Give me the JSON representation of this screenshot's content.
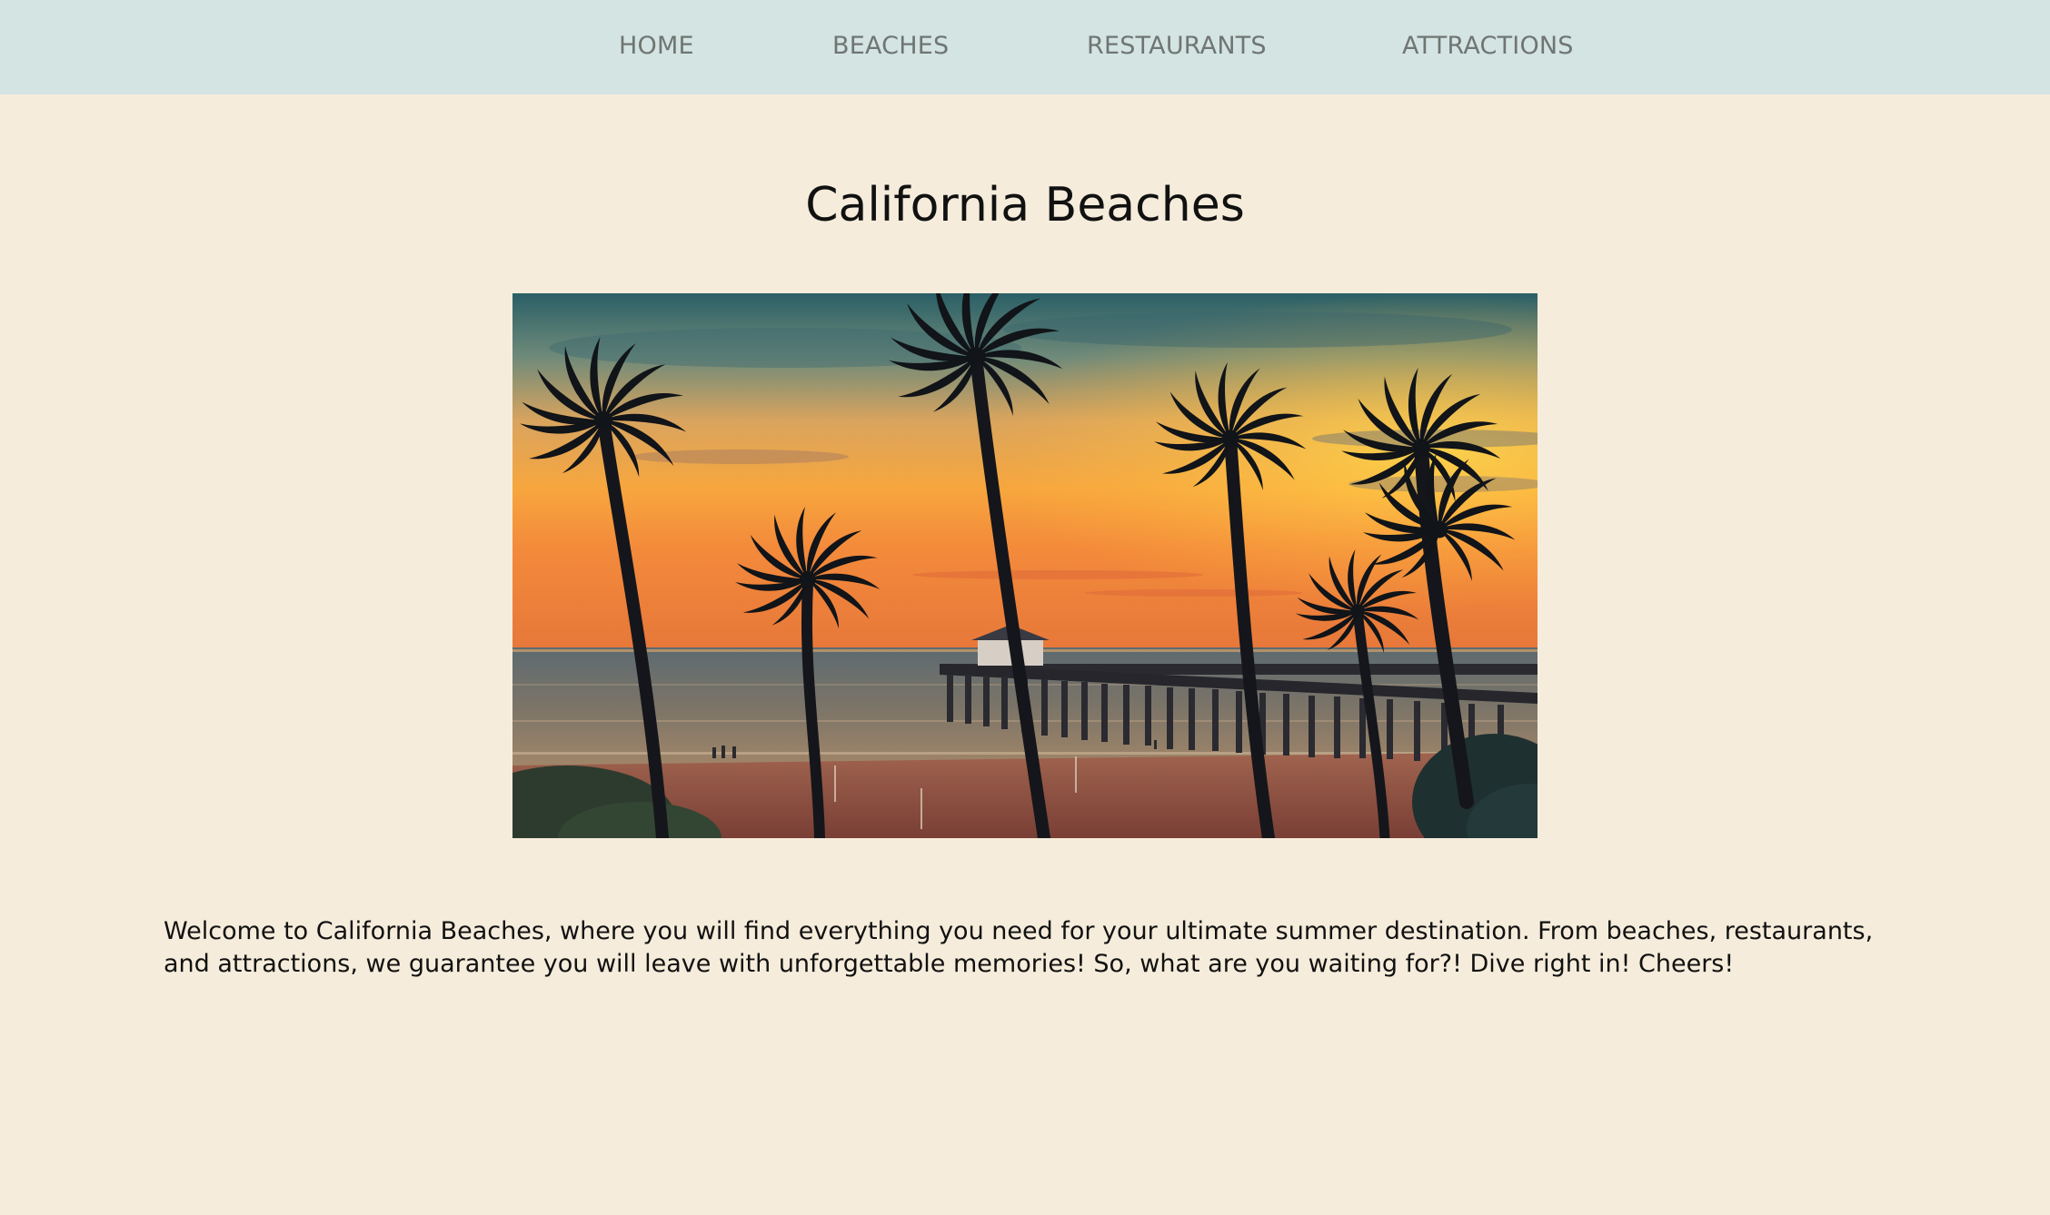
{
  "nav": {
    "items": [
      {
        "label": "HOME"
      },
      {
        "label": "BEACHES"
      },
      {
        "label": "RESTAURANTS"
      },
      {
        "label": "ATTRACTIONS"
      }
    ]
  },
  "main": {
    "title": "California Beaches",
    "hero_image": {
      "icon": "sunset-palm-beach-pier-photo"
    },
    "intro_text": "Welcome to California Beaches, where you will find everything you need for your ultimate summer destination. From beaches, restaurants, and attractions, we guarantee you will leave with unforgettable memories! So, what are you waiting for?! Dive right in! Cheers!"
  },
  "colors": {
    "page_background": "#f5ecdb",
    "nav_background": "#d3e4e2",
    "nav_text": "#6f7572",
    "body_text": "#111111"
  }
}
